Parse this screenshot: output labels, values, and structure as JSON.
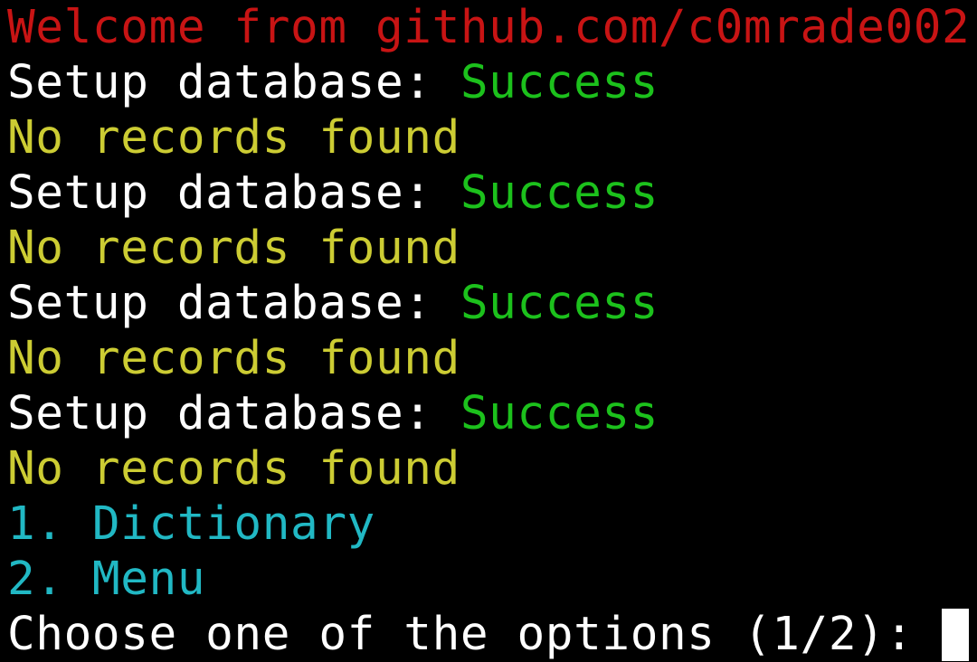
{
  "terminal": {
    "welcome": "Welcome from github.com/c0mrade002",
    "setup_label": "Setup database: ",
    "setup_status": "Success",
    "no_records": "No records found",
    "menu": [
      {
        "label": "1. Dictionary"
      },
      {
        "label": "2. Menu"
      }
    ],
    "prompt": "Choose one of the options (1/2): ",
    "colors": {
      "welcome": "#c81414",
      "label": "#ffffff",
      "success": "#1cc11c",
      "warning": "#cccc33",
      "menu": "#21b8c4",
      "background": "#000000"
    }
  }
}
